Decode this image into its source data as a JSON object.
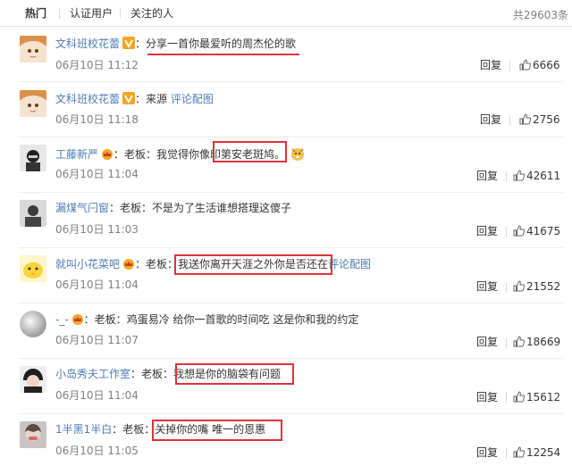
{
  "tabs": {
    "hot": "热门",
    "verified": "认证用户",
    "following": "关注的人"
  },
  "total_count": "共29603条",
  "reply_label": "回复",
  "comments": [
    {
      "user": "文科班校花蕾",
      "prefix": "：",
      "text": "分享一首你最爱听的周杰伦的歌",
      "link": "",
      "time": "06月10日 11:12",
      "likes": "6666"
    },
    {
      "user": "文科班校花蕾",
      "prefix": "：",
      "text": "来源",
      "link": "评论配图",
      "time": "06月10日 11:18",
      "likes": "2756"
    },
    {
      "user": "工藤新严",
      "prefix": "：老板：我觉得你像",
      "text": "印第安老斑鸠。",
      "link": "",
      "time": "06月10日 11:04",
      "likes": "42611"
    },
    {
      "user": "漏煤气闩窗",
      "prefix": "：老板：",
      "text": "不是为了生活谁想搭理这傻子",
      "link": "",
      "time": "06月10日 11:03",
      "likes": "41675"
    },
    {
      "user": "就叫小花菜吧",
      "prefix": "：老板：",
      "text": "我送你离开天涯之外你是否还在",
      "link": "评论配图",
      "time": "06月10日 11:04",
      "likes": "21552"
    },
    {
      "user": "-_-",
      "prefix": "：老板：",
      "text": "鸡蛋易冷 给你一首歌的时间吃 这是你和我的约定",
      "link": "",
      "time": "06月10日 11:07",
      "likes": "18669"
    },
    {
      "user": "小岛秀夫工作室",
      "prefix": "：老板：",
      "text": "我想是你的脑袋有问题",
      "link": "",
      "time": "06月10日 11:04",
      "likes": "15612"
    },
    {
      "user": "1半黑1半白",
      "prefix": "：老板：",
      "text": "关掉你的嘴 唯一的恩惠",
      "link": "",
      "time": "06月10日 11:05",
      "likes": "12254"
    }
  ],
  "colors": {
    "name": "#4f7ab5",
    "highlight": "#e0323a",
    "muted": "#808080"
  }
}
